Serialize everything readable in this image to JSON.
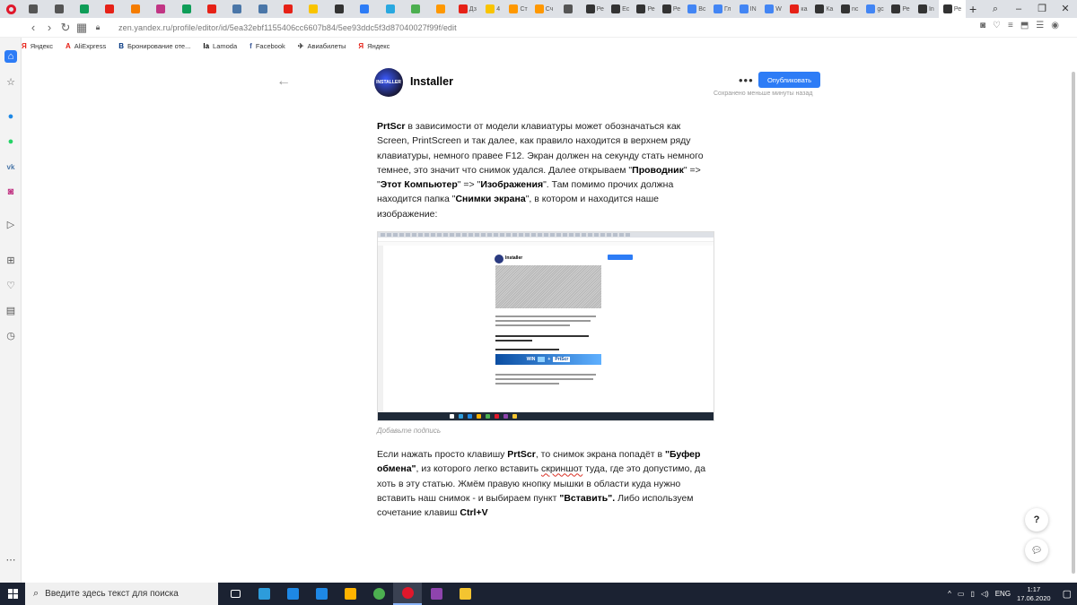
{
  "browser": {
    "tabs": [
      {
        "label": "",
        "color": "#555555"
      },
      {
        "label": "",
        "color": "#555555"
      },
      {
        "label": "",
        "color": "#0f9d58"
      },
      {
        "label": "",
        "color": "#e62117"
      },
      {
        "label": "",
        "color": "#f57c00"
      },
      {
        "label": "",
        "color": "#c13584"
      },
      {
        "label": "",
        "color": "#0f9d58"
      },
      {
        "label": "",
        "color": "#e62117"
      },
      {
        "label": "",
        "color": "#4a76a8"
      },
      {
        "label": "",
        "color": "#4a76a8"
      },
      {
        "label": "",
        "color": "#e62117"
      },
      {
        "label": "",
        "color": "#f9c400"
      },
      {
        "label": "",
        "color": "#333333"
      },
      {
        "label": "",
        "color": "#2d7cf6"
      },
      {
        "label": "",
        "color": "#29a8e0"
      },
      {
        "label": "",
        "color": "#4caf50"
      },
      {
        "label": "",
        "color": "#ff9800"
      },
      {
        "label": "Дз",
        "color": "#e62117"
      },
      {
        "label": "4",
        "color": "#f9c400"
      },
      {
        "label": "Ст",
        "color": "#ff9800"
      },
      {
        "label": "Сч",
        "color": "#ff9800"
      },
      {
        "label": "",
        "color": "#555555"
      },
      {
        "label": "Ре",
        "color": "#333333"
      },
      {
        "label": "Ес",
        "color": "#333333"
      },
      {
        "label": "Ре",
        "color": "#333333"
      },
      {
        "label": "Ре",
        "color": "#333333"
      },
      {
        "label": "Вс",
        "color": "#4285f4"
      },
      {
        "label": "Гл",
        "color": "#4285f4"
      },
      {
        "label": "IN",
        "color": "#4285f4"
      },
      {
        "label": "W",
        "color": "#4285f4"
      },
      {
        "label": "ка",
        "color": "#e62117"
      },
      {
        "label": "Ка",
        "color": "#333333"
      },
      {
        "label": "nc",
        "color": "#333333"
      },
      {
        "label": "gc",
        "color": "#4285f4"
      },
      {
        "label": "Ре",
        "color": "#333333"
      },
      {
        "label": "In",
        "color": "#333333"
      },
      {
        "label": "Ре",
        "color": "#333333"
      }
    ],
    "url": "zen.yandex.ru/profile/editor/id/5ea32ebf1155406cc6607b84/5ee93ddc5f3d87040027f99f/edit",
    "bookmarks": [
      {
        "label": "Яндекс",
        "icon": "Я",
        "color": "#e62117"
      },
      {
        "label": "AliExpress",
        "icon": "A",
        "color": "#e62117"
      },
      {
        "label": "Бронирование оте...",
        "icon": "B",
        "color": "#003580"
      },
      {
        "label": "Lamoda",
        "icon": "la",
        "color": "#000000"
      },
      {
        "label": "Facebook",
        "icon": "f",
        "color": "#3b5998"
      },
      {
        "label": "Авиабилеты",
        "icon": "✈",
        "color": "#333333"
      },
      {
        "label": "Яндекс",
        "icon": "Я",
        "color": "#e62117"
      }
    ]
  },
  "editor": {
    "channel_name": "Installer",
    "avatar_text": "INSTALLER",
    "publish_label": "Опубликовать",
    "saved_status": "Сохранено меньше минуты назад",
    "caption_placeholder": "Добавьте подпись",
    "paragraph1": {
      "b1": "PrtScr",
      "t1": " в зависимости от модели клавиатуры может обозначаться как Screen, PrintScreen и так далее, как правило находится в верхнем ряду клавиатуры, немного правее F12. Экран должен на секунду стать немного темнее, это значит что снимок удался. Далее открываем \"",
      "b2": "Проводник",
      "t2": "\" => \"",
      "b3": "Этот Компьютер",
      "t3": "\" => \"",
      "b4": "Изображения",
      "t4": "\". Там помимо прочих должна находится папка \"",
      "b5": "Снимки экрана",
      "t5": "\", в котором и находится наше изображение:"
    },
    "paragraph2": {
      "t1": "Если нажать просто клавишу ",
      "b1": "PrtScr",
      "t2": ", то снимок экрана попадёт в ",
      "b2": "\"Буфер обмена\"",
      "t3": ", из которого легко вставить ",
      "u1": "скриншот",
      "t4": " туда, где это допустимо, да хоть в эту статью. Жмём правую кнопку мышки в области куда нужно вставить наш снимок - и выбираем пункт ",
      "b3": "\"Вставить\".",
      "t5": " Либо используем сочетание клавиш ",
      "b4": "Ctrl+V"
    },
    "embedded_screenshot": {
      "channel_name": "Installer",
      "banner_left": "WIN",
      "banner_right": "PrtScr"
    },
    "help_label": "?"
  },
  "taskbar": {
    "search_placeholder": "Введите здесь текст для поиска",
    "language": "ENG",
    "time": "1:17",
    "date": "17.06.2020",
    "apps": [
      {
        "name": "task-view",
        "color": "#ffffff"
      },
      {
        "name": "photos",
        "color": "#2d9cdb"
      },
      {
        "name": "edge",
        "color": "#1e88e5"
      },
      {
        "name": "mail",
        "color": "#1e88e5"
      },
      {
        "name": "store",
        "color": "#ffb300"
      },
      {
        "name": "chrome",
        "color": "#4caf50"
      },
      {
        "name": "opera",
        "color": "#e0172b"
      },
      {
        "name": "game",
        "color": "#8e44ad"
      },
      {
        "name": "explorer",
        "color": "#f4c430"
      }
    ]
  }
}
